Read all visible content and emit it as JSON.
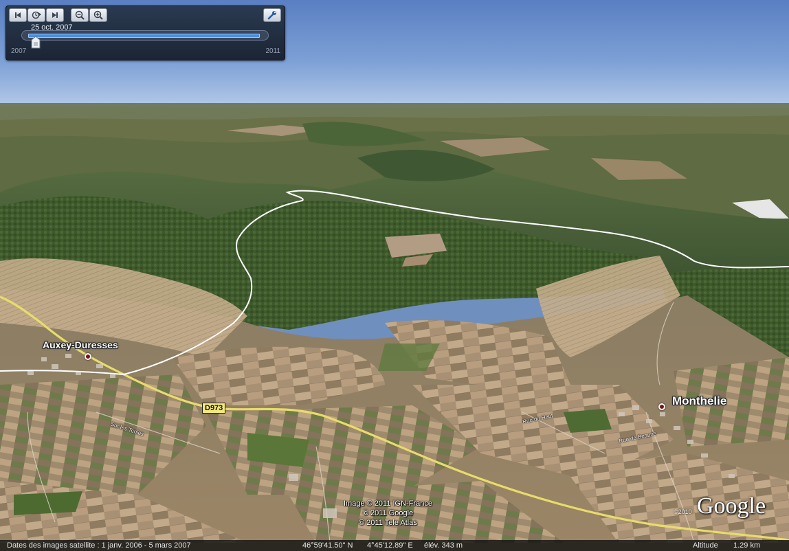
{
  "time_slider": {
    "date_label": "25 oct. 2007",
    "year_start": "2007",
    "year_end": "2011",
    "position": 0.03
  },
  "map": {
    "places": [
      {
        "name": "Auxey-Duresses"
      },
      {
        "name": "Monthelie"
      }
    ],
    "road_shield": "D973",
    "copyright": [
      "Image © 2011 IGN-France",
      "© 2011 Google",
      "© 2011 Tele Atlas"
    ],
    "logo_year": "©2010",
    "logo": "Google"
  },
  "status_bar": {
    "imagery_dates": "Dates des images satellite :  1 janv. 2006 - 5 mars 2007",
    "latitude": "46°59'41.50\" N",
    "longitude": "4°45'12.89\" E",
    "elevation": "élév.  343 m",
    "altitude_label": "Altitude",
    "altitude_value": "1.29 km"
  },
  "colors": {
    "panel": "#1b2534",
    "slider_fill": "#4a8ee0",
    "pin": "#7b0e10",
    "road": "#e8dc6a"
  }
}
